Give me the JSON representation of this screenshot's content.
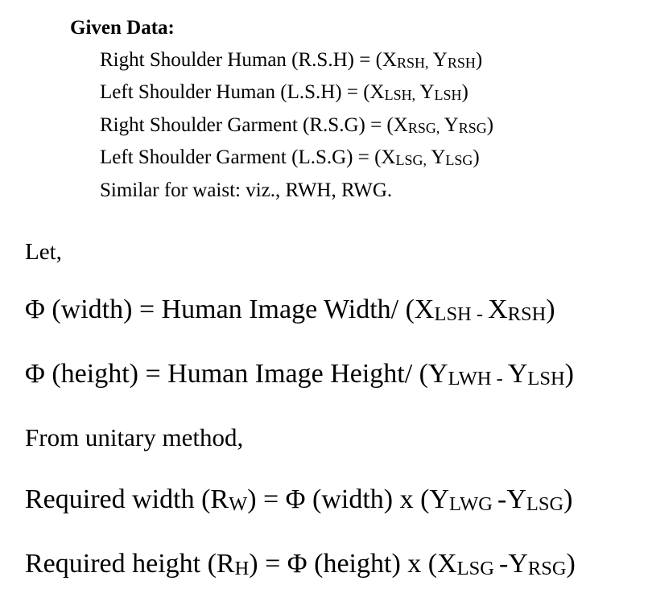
{
  "given": {
    "heading": "Given Data:",
    "lines": [
      [
        {
          "t": "Right Shoulder Human (R.S.H) = (X"
        },
        {
          "s": "RSH,"
        },
        {
          "t": " Y"
        },
        {
          "s": "RSH"
        },
        {
          "t": ")"
        }
      ],
      [
        {
          "t": "Left Shoulder Human (L.S.H) = (X"
        },
        {
          "s": "LSH,"
        },
        {
          "t": " Y"
        },
        {
          "s": "LSH"
        },
        {
          "t": ")"
        }
      ],
      [
        {
          "t": "Right Shoulder Garment (R.S.G) = (X"
        },
        {
          "s": "RSG,"
        },
        {
          "t": " Y"
        },
        {
          "s": "RSG"
        },
        {
          "t": ")"
        }
      ],
      [
        {
          "t": "Left Shoulder Garment (L.S.G) = (X"
        },
        {
          "s": "LSG,"
        },
        {
          "t": " Y"
        },
        {
          "s": "LSG"
        },
        {
          "t": ")"
        }
      ],
      [
        {
          "t": "Similar for waist: viz., RWH, RWG."
        }
      ]
    ]
  },
  "let": "Let,",
  "phi_width": [
    {
      "t": "Φ (width) = Human Image Width/ (X"
    },
    {
      "s": "LSH - "
    },
    {
      "t": "X"
    },
    {
      "s": "RSH"
    },
    {
      "t": ")"
    }
  ],
  "phi_height": [
    {
      "t": "Φ (height) = Human Image Height/ (Y"
    },
    {
      "s": "LWH - "
    },
    {
      "t": "Y"
    },
    {
      "s": "LSH"
    },
    {
      "t": ")"
    }
  ],
  "unitary": "From unitary method,",
  "required_width": [
    {
      "t": "Required width (R"
    },
    {
      "s": "W"
    },
    {
      "t": ") = Φ (width) x (Y"
    },
    {
      "s": "LWG "
    },
    {
      "t": "-Y"
    },
    {
      "s": "LSG"
    },
    {
      "t": ")"
    }
  ],
  "required_height": [
    {
      "t": "Required height (R"
    },
    {
      "s": "H"
    },
    {
      "t": ") = Φ (height) x (X"
    },
    {
      "s": "LSG "
    },
    {
      "t": "-Y"
    },
    {
      "s": "RSG"
    },
    {
      "t": ")"
    }
  ]
}
